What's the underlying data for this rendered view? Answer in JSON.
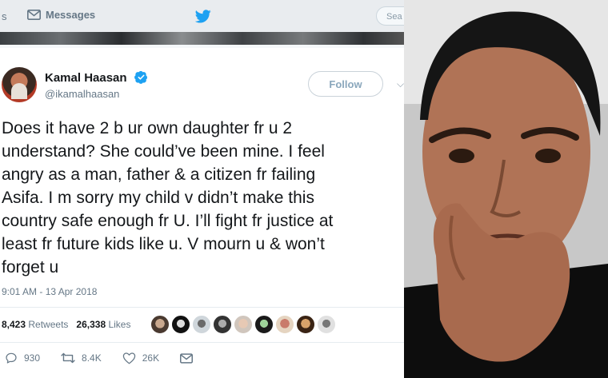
{
  "topbar": {
    "left_fragment": "s",
    "messages_label": "Messages",
    "search_placeholder": "Sea"
  },
  "tweet": {
    "display_name": "Kamal Haasan",
    "handle": "@ikamalhaasan",
    "follow_label": "Follow",
    "text": "Does it have 2 b ur own daughter fr u 2\nunderstand? She could’ve been mine. I feel\nangry as a man, father & a citizen fr failing\nAsifa. I m sorry my child v didn’t make this\ncountry safe enough fr U. I’ll fight fr justice at\nleast fr future kids like u. V mourn u & won’t\nforget u",
    "timestamp": "9:01 AM - 13 Apr 2018",
    "retweets_count": "8,423",
    "retweets_label": "Retweets",
    "likes_count": "26,338",
    "likes_label": "Likes",
    "reply_count": "930",
    "retweet_action_count": "8.4K",
    "like_action_count": "26K"
  },
  "colors": {
    "twitter_blue": "#1da1f2",
    "verified_blue": "#1da1f2",
    "muted_text": "#657786"
  }
}
